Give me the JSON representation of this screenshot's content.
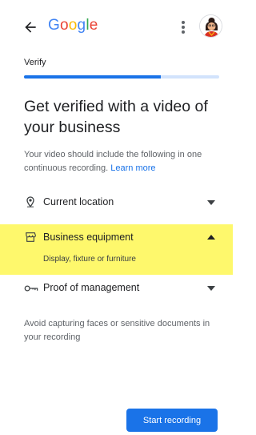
{
  "header": {
    "logo_letters": [
      {
        "char": "G",
        "color": "#4285F4"
      },
      {
        "char": "o",
        "color": "#EA4335"
      },
      {
        "char": "o",
        "color": "#FBBC05"
      },
      {
        "char": "g",
        "color": "#4285F4"
      },
      {
        "char": "l",
        "color": "#34A853"
      },
      {
        "char": "e",
        "color": "#EA4335"
      }
    ],
    "back_icon": "arrow-left-icon",
    "menu_icon": "more-vert-icon"
  },
  "step": {
    "label": "Verify",
    "progress_fraction": 0.7
  },
  "main": {
    "headline": "Get verified with a video of your business",
    "description": "Your video should include the following in one continuous recording.",
    "learn_more": "Learn more",
    "note": "Avoid capturing faces or sensitive documents in your recording"
  },
  "accordion": [
    {
      "label": "Current location",
      "icon": "location-pin-icon",
      "expanded": false
    },
    {
      "label": "Business equipment",
      "icon": "storefront-icon",
      "expanded": true,
      "detail": "Display, fixture or furniture"
    },
    {
      "label": "Proof of management",
      "icon": "key-icon",
      "expanded": false
    }
  ],
  "actions": {
    "start_recording": "Start recording"
  },
  "colors": {
    "accent": "#1a73e8",
    "highlight": "#fef86c"
  }
}
